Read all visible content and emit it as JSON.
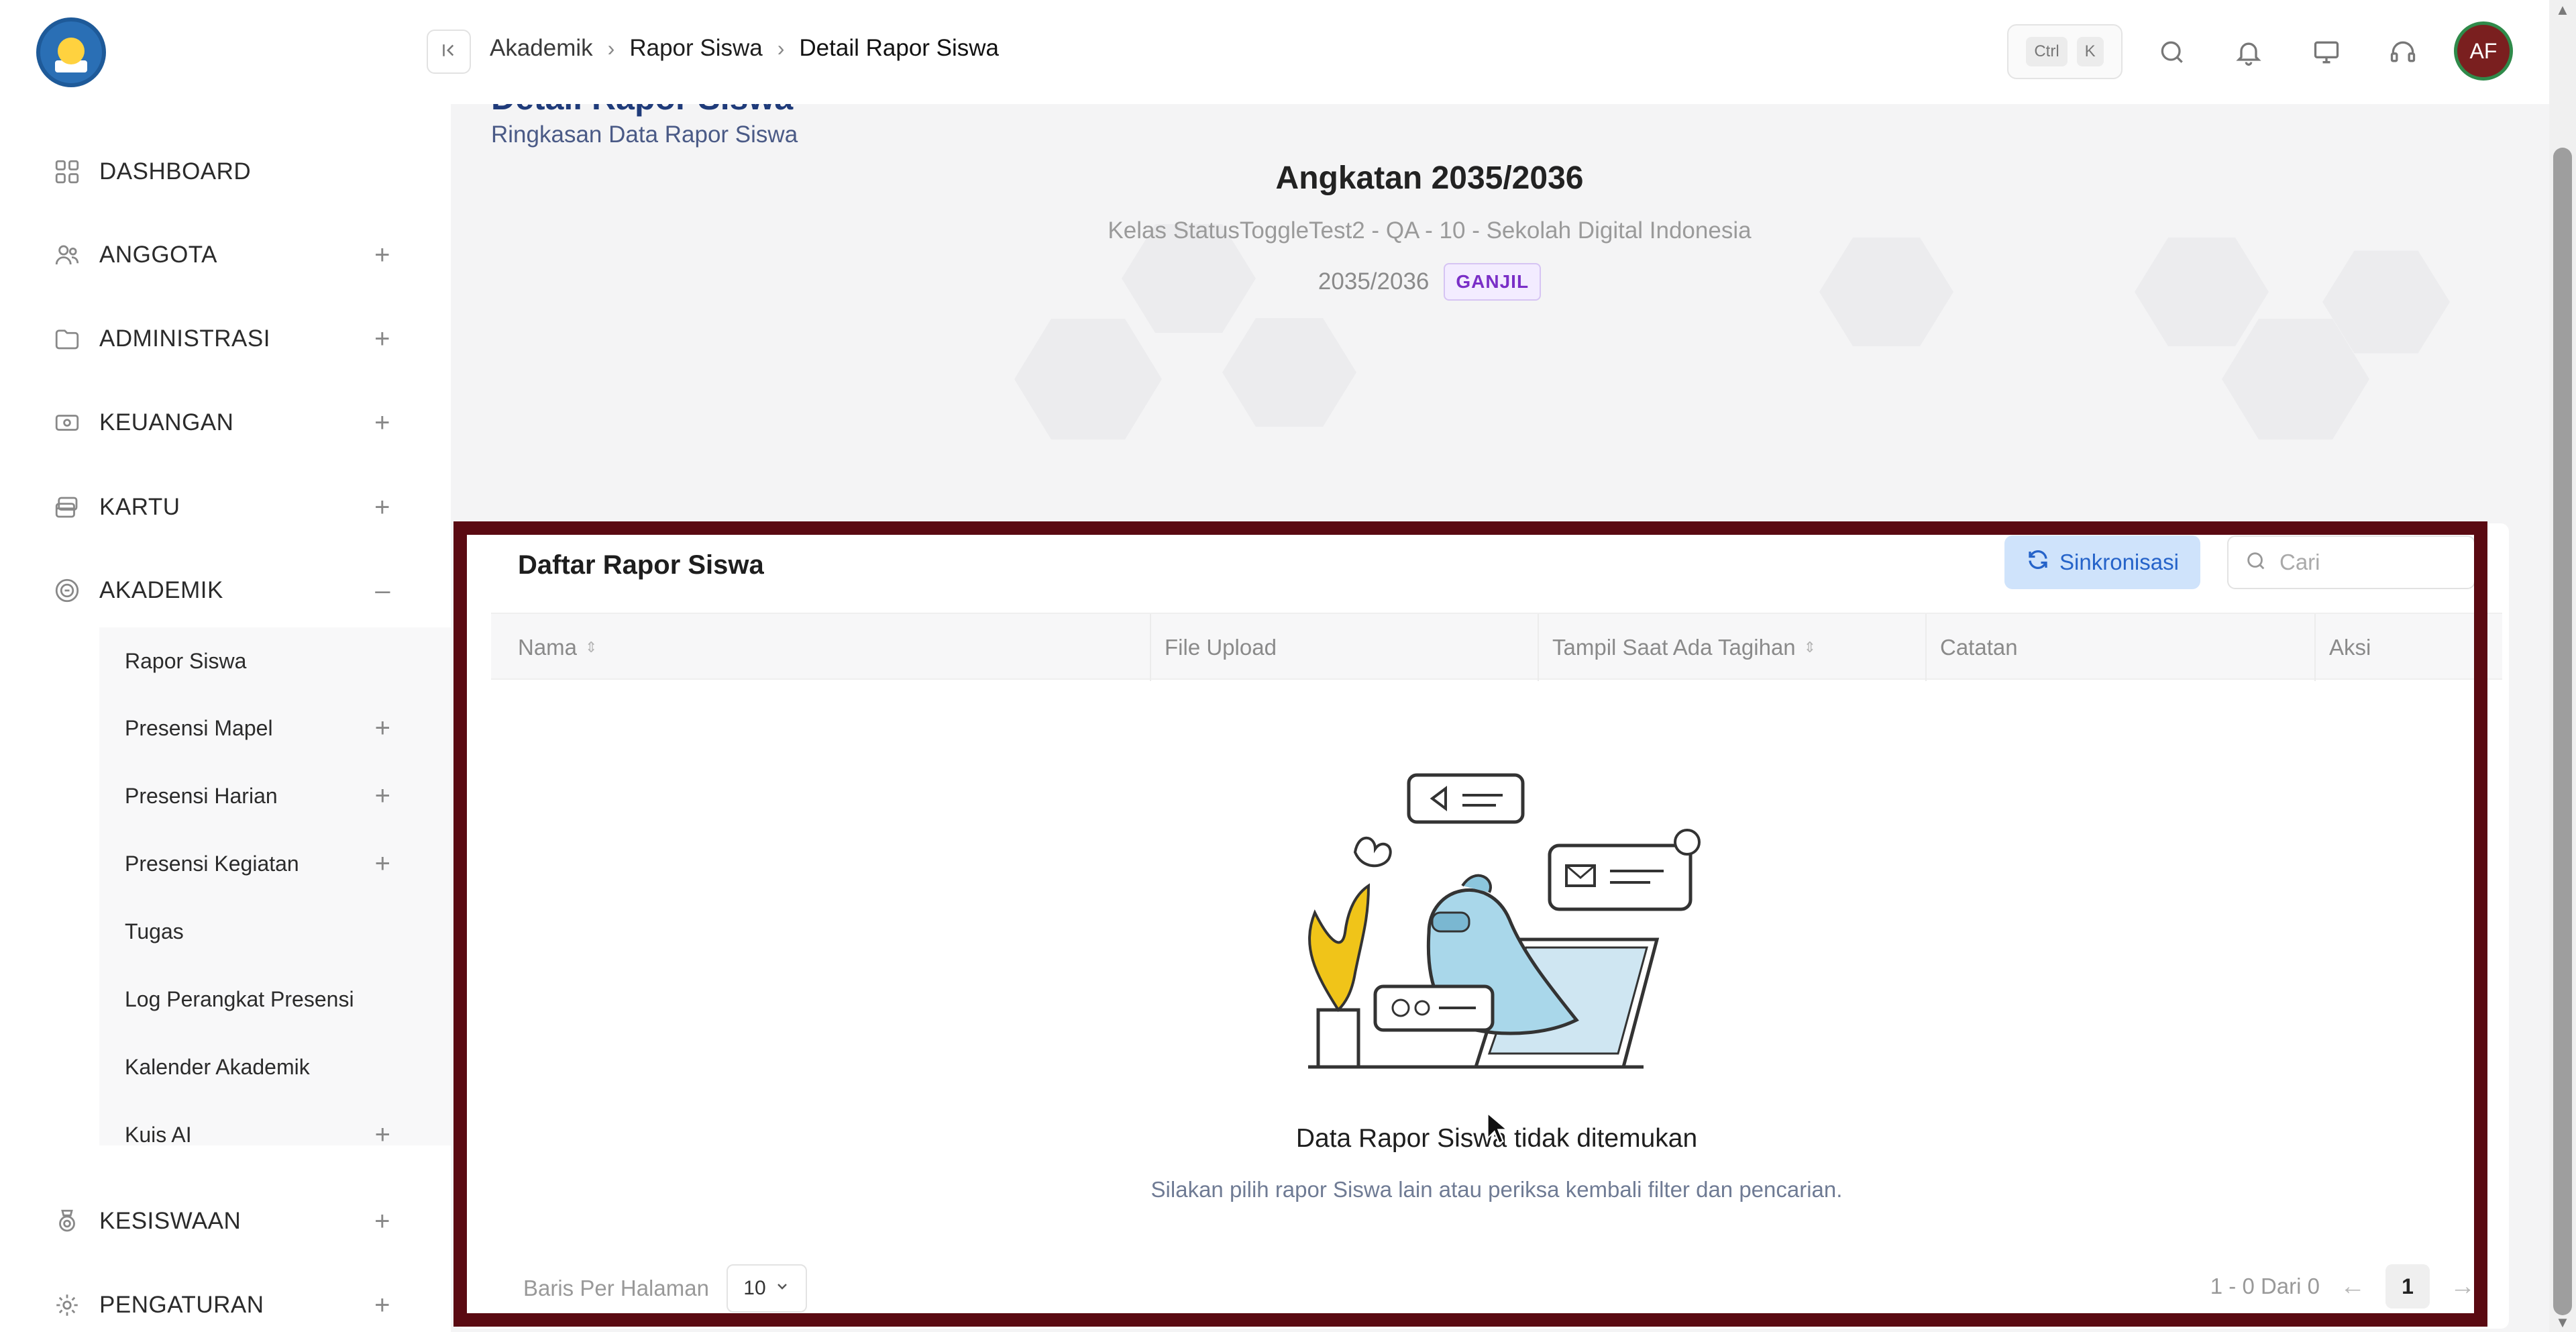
{
  "sidebar": {
    "items": [
      {
        "label": "DASHBOARD",
        "icon": "grid-icon",
        "expandable": false
      },
      {
        "label": "ANGGOTA",
        "icon": "users-icon",
        "expandable": true,
        "toggle": "+"
      },
      {
        "label": "ADMINISTRASI",
        "icon": "folder-icon",
        "expandable": true,
        "toggle": "+"
      },
      {
        "label": "KEUANGAN",
        "icon": "money-icon",
        "expandable": true,
        "toggle": "+"
      },
      {
        "label": "KARTU",
        "icon": "cards-icon",
        "expandable": true,
        "toggle": "+"
      },
      {
        "label": "AKADEMIK",
        "icon": "academic-icon",
        "expandable": true,
        "toggle": "–"
      },
      {
        "label": "KESISWAAN",
        "icon": "badge-icon",
        "expandable": true,
        "toggle": "+"
      },
      {
        "label": "PENGATURAN",
        "icon": "settings-icon",
        "expandable": true,
        "toggle": "+"
      }
    ],
    "sub_items": [
      {
        "label": "Rapor Siswa",
        "toggle": ""
      },
      {
        "label": "Presensi Mapel",
        "toggle": "+"
      },
      {
        "label": "Presensi Harian",
        "toggle": "+"
      },
      {
        "label": "Presensi Kegiatan",
        "toggle": "+"
      },
      {
        "label": "Tugas",
        "toggle": ""
      },
      {
        "label": "Log Perangkat Presensi",
        "toggle": ""
      },
      {
        "label": "Kalender Akademik",
        "toggle": ""
      },
      {
        "label": "Kuis AI",
        "toggle": "+"
      }
    ]
  },
  "topbar": {
    "breadcrumb": [
      "Akademik",
      "Rapor Siswa",
      "Detail Rapor Siswa"
    ],
    "shortcut_keys": [
      "Ctrl",
      "K"
    ],
    "avatar_initials": "AF",
    "icons": [
      "search-icon",
      "bell-icon",
      "monitor-icon",
      "headset-icon"
    ]
  },
  "page": {
    "title": "Detail Rapor Siswa",
    "subtitle": "Ringkasan Data Rapor Siswa"
  },
  "hero": {
    "title": "Angkatan 2035/2036",
    "subtitle": "Kelas StatusToggleTest2 - QA - 10 - Sekolah Digital Indonesia",
    "year": "2035/2036",
    "semester_badge": "GANJIL"
  },
  "list": {
    "title": "Daftar Rapor Siswa",
    "sync_label": "Sinkronisasi",
    "search_placeholder": "Cari",
    "columns": [
      "Nama",
      "File Upload",
      "Tampil Saat Ada Tagihan",
      "Catatan",
      "Aksi"
    ],
    "empty_title": "Data Rapor Siswa tidak ditemukan",
    "empty_subtitle": "Silakan pilih rapor Siswa lain atau periksa kembali filter dan pencarian.",
    "rows_per_page_label": "Baris Per Halaman",
    "rows_per_page_value": "10",
    "pagination_summary": "1 - 0 Dari 0",
    "current_page": "1",
    "prev_arrow": "←",
    "next_arrow": "→"
  },
  "colors": {
    "accent_blue": "#2563c9",
    "badge_purple": "#7a2fc7",
    "highlight_frame": "#5a0a12",
    "avatar_bg": "#7a1f1f"
  }
}
